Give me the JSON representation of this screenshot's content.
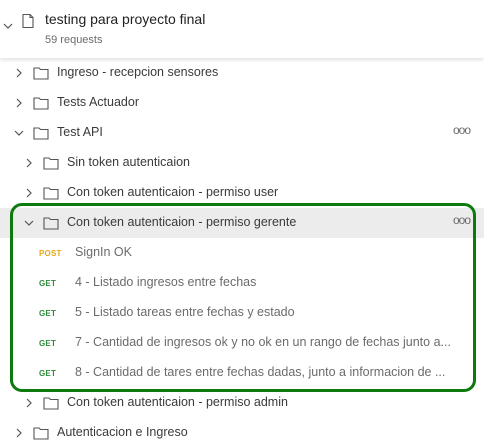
{
  "collection": {
    "title": "testing para proyecto final",
    "subtitle": "59 requests"
  },
  "folders": {
    "ingreso": "Ingreso - recepcion sensores",
    "tests_actuador": "Tests Actuador",
    "test_api": "Test API",
    "sin_token": "Sin token autenticaion",
    "con_token_user": "Con token autenticaion - permiso user",
    "con_token_gerente": "Con token autenticaion - permiso gerente",
    "con_token_admin": "Con token autenticaion - permiso admin",
    "autenticacion": "Autenticacion e Ingreso"
  },
  "more_label": "ooo",
  "requests": [
    {
      "method": "POST",
      "name": "SignIn OK"
    },
    {
      "method": "GET",
      "name": "4 - Listado ingresos entre fechas"
    },
    {
      "method": "GET",
      "name": "5 - Listado tareas entre fechas y estado"
    },
    {
      "method": "GET",
      "name": "7 - Cantidad de ingresos ok y no ok en un rango de fechas junto a..."
    },
    {
      "method": "GET",
      "name": "8 - Cantidad de tares entre fechas dadas, junto a informacion de ..."
    }
  ],
  "colors": {
    "post": "#e8a515",
    "get": "#2e8b3a",
    "highlight": "#0d7a0d",
    "selected_bg": "#ececec"
  }
}
